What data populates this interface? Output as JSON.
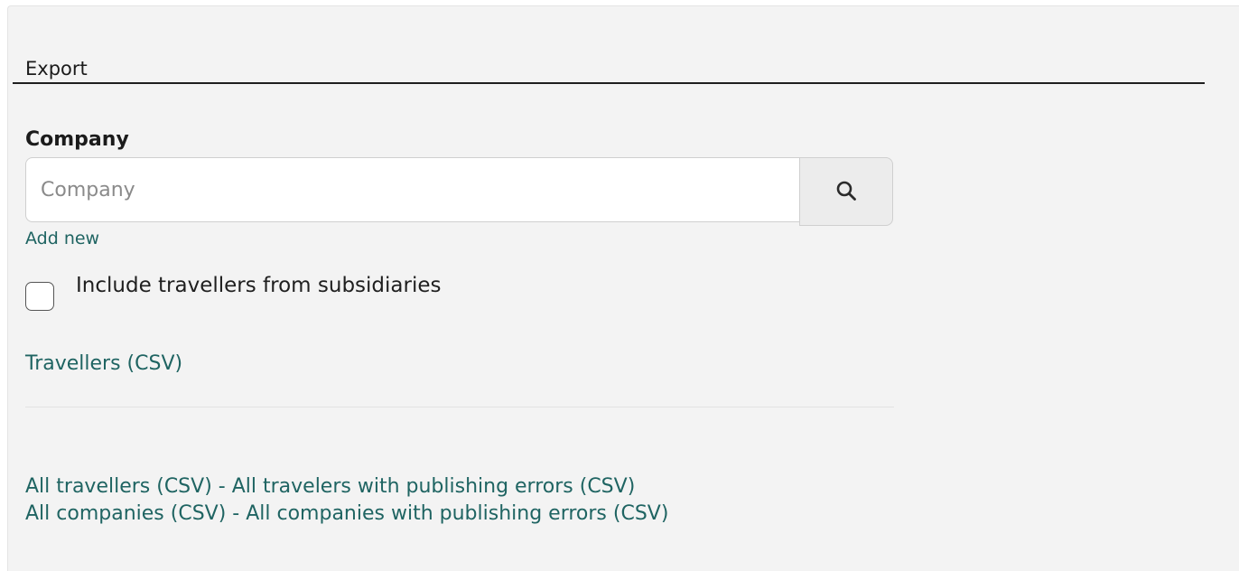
{
  "section": {
    "title": "Export"
  },
  "company": {
    "label": "Company",
    "input_placeholder": "Company",
    "input_value": "",
    "add_new": "Add new"
  },
  "subsidiaries_checkbox": {
    "label": "Include travellers from subsidiaries",
    "checked": false
  },
  "travellers_csv": "Travellers (CSV)",
  "bulk_exports": {
    "line1": {
      "first": "All travellers (CSV)",
      "separator": " - ",
      "second": "All travelers with publishing errors (CSV)"
    },
    "line2": {
      "first": "All companies (CSV)",
      "separator": " - ",
      "second": "All companies with publishing errors (CSV)"
    }
  },
  "icons": {
    "search_button": "search-icon"
  },
  "colors": {
    "link": "#1f6462",
    "panel_background": "#f3f3f3"
  }
}
